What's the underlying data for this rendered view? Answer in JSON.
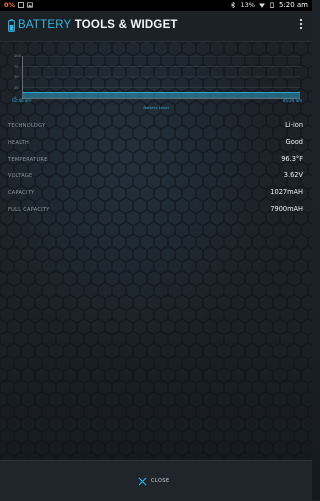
{
  "status_bar": {
    "notification_text": "0%",
    "battery_percent": "13%",
    "time": "5:20 am",
    "icons": [
      "notification-icon",
      "image-icon",
      "bluetooth-icon",
      "wifi-icon",
      "battery-icon"
    ]
  },
  "action_bar": {
    "title_accent": "BATTERY",
    "title_rest": " TOOLS & WIDGET",
    "menu_icon": "overflow-menu-icon"
  },
  "chart_data": {
    "type": "area",
    "y_ticks": [
      "100",
      "75",
      "50",
      "25",
      "0"
    ],
    "x_start_label": "02:40 am",
    "x_end_label": "05:20 am",
    "xlabel": "Battery Level",
    "ylim": [
      0,
      100
    ],
    "series": [
      {
        "values": [
          13,
          13,
          13,
          13,
          13,
          13,
          13,
          13,
          13,
          13,
          13
        ]
      }
    ],
    "grid": true,
    "color": "#33b5e5"
  },
  "info": {
    "rows": [
      {
        "label": "TECHNOLOGY",
        "value": "Li-ion"
      },
      {
        "label": "HEALTH",
        "value": "Good"
      },
      {
        "label": "TEMPERATURE",
        "value": "96.3°F"
      },
      {
        "label": "VOLTAGE",
        "value": "3.62V"
      },
      {
        "label": "CAPACITY",
        "value": "1027mAH"
      },
      {
        "label": "FULL CAPACITY",
        "value": "7900mAH"
      }
    ]
  },
  "bottom": {
    "close_label": "CLOSE"
  },
  "colors": {
    "accent": "#33b5e5",
    "background": "#1a1f24"
  }
}
